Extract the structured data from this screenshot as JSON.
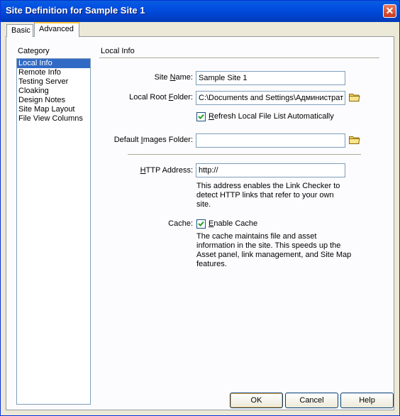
{
  "window": {
    "title": "Site Definition for Sample Site 1",
    "close_label": "✕"
  },
  "tabs": [
    {
      "label": "Basic"
    },
    {
      "label": "Advanced"
    }
  ],
  "category": {
    "label": "Category",
    "items": [
      {
        "label": "Local Info",
        "selected": true
      },
      {
        "label": "Remote Info"
      },
      {
        "label": "Testing Server"
      },
      {
        "label": "Cloaking"
      },
      {
        "label": "Design Notes"
      },
      {
        "label": "Site Map Layout"
      },
      {
        "label": "File View Columns"
      }
    ]
  },
  "local_info": {
    "section_title": "Local Info",
    "site_name_label_pre": "Site ",
    "site_name_label_ul": "N",
    "site_name_label_post": "ame:",
    "site_name_value": "Sample Site 1",
    "local_root_label_pre": "Local Root ",
    "local_root_label_ul": "F",
    "local_root_label_post": "older:",
    "local_root_value": "C:\\Documents and Settings\\Администрат",
    "refresh_label_ul": "R",
    "refresh_label_post": "efresh Local File List Automatically",
    "refresh_checked": true,
    "default_images_label_pre": "Default ",
    "default_images_label_ul": "I",
    "default_images_label_post": "mages Folder:",
    "default_images_value": "",
    "http_label_ul": "H",
    "http_label_post": "TTP Address:",
    "http_value": "http://",
    "http_note": "This address enables the Link Checker to detect HTTP links that refer to your own site.",
    "cache_label": "Cache:",
    "cache_check_ul": "E",
    "cache_check_post": "nable Cache",
    "cache_checked": true,
    "cache_note": "The cache maintains file and asset information in the site.  This speeds up the Asset panel, link management, and Site Map features."
  },
  "buttons": {
    "ok": "OK",
    "cancel": "Cancel",
    "help": "Help"
  }
}
